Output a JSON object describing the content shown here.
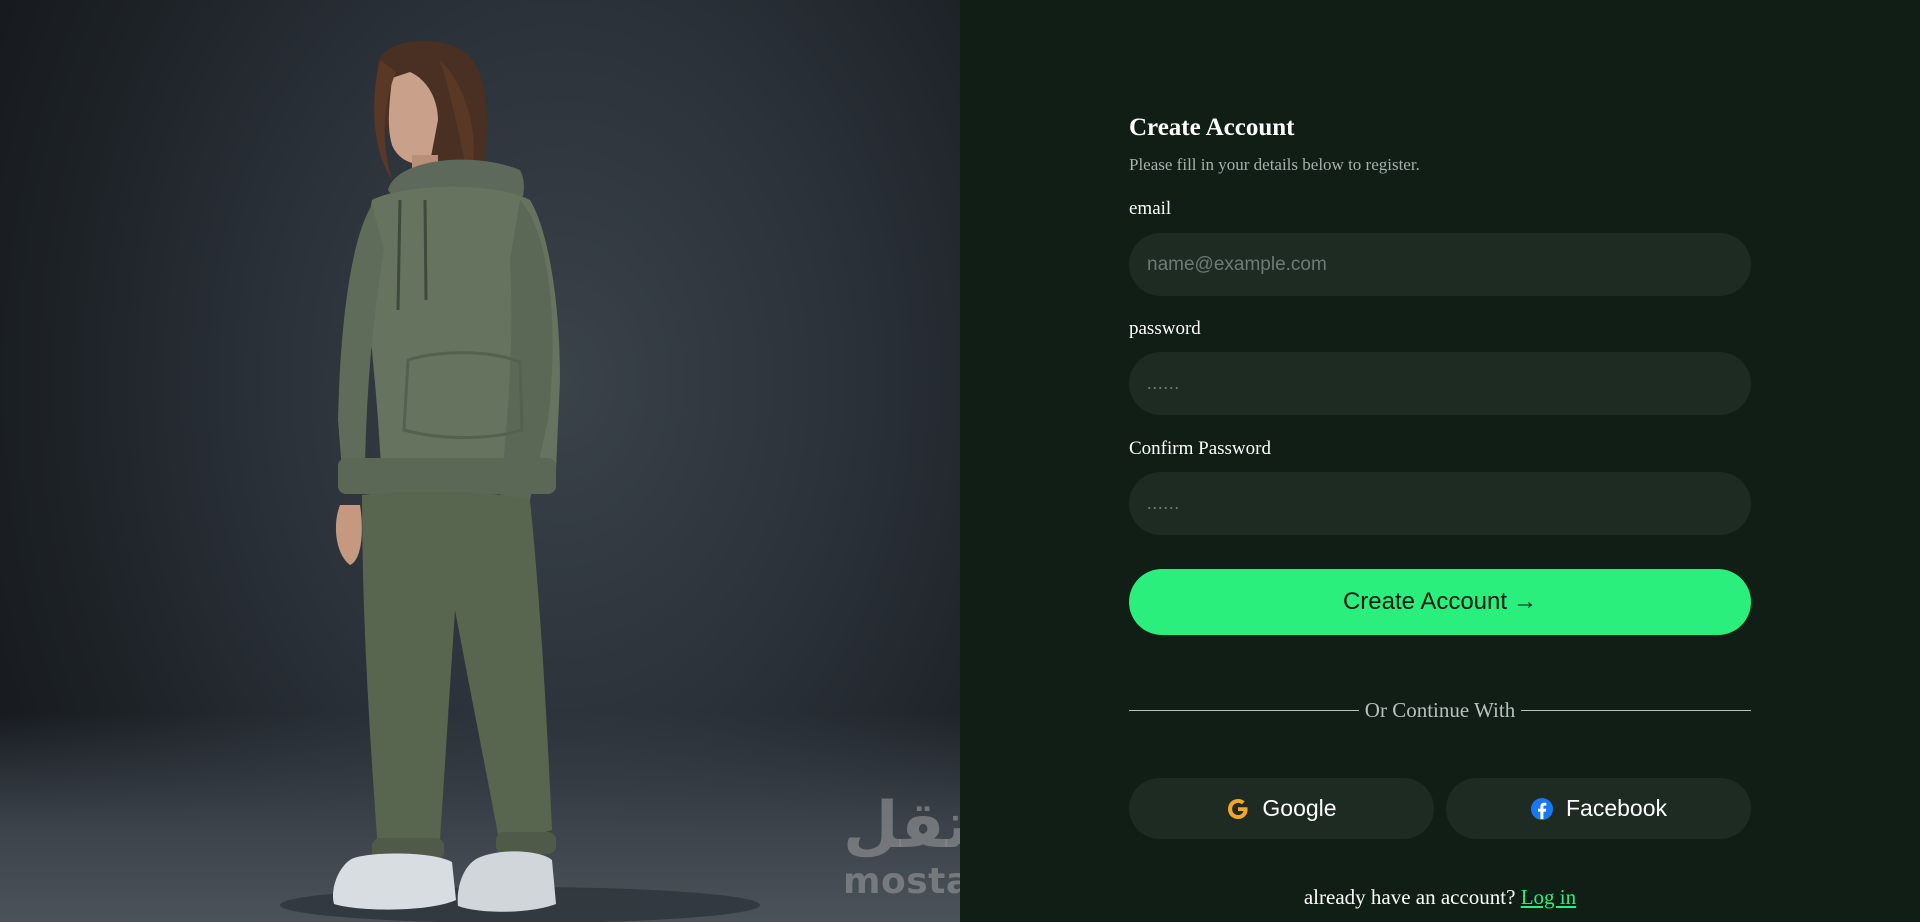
{
  "form": {
    "title": "Create Account",
    "subtitle": "Please fill in your details below to register.",
    "email": {
      "label": "email",
      "placeholder": "name@example.com",
      "value": ""
    },
    "password": {
      "label": "password",
      "placeholder": "......",
      "value": ""
    },
    "confirm_password": {
      "label": "Confirm Password",
      "placeholder": "......",
      "value": ""
    },
    "submit_label": "Create Account",
    "submit_arrow": "→",
    "divider_text": "Or Continue With",
    "social": {
      "google_label": "Google",
      "google_icon": "google-icon",
      "facebook_label": "Facebook",
      "facebook_icon": "facebook-icon"
    },
    "login_prompt": "already have an account?",
    "login_link": "Log in"
  },
  "watermark": {
    "arabic": "مستقل",
    "latin": "mostaql.com"
  },
  "colors": {
    "accent": "#2aef7c",
    "panel_background": "#101e16",
    "input_background": "#1d2b23",
    "google_icon": "#f5a623",
    "facebook_icon": "#1877f2"
  }
}
